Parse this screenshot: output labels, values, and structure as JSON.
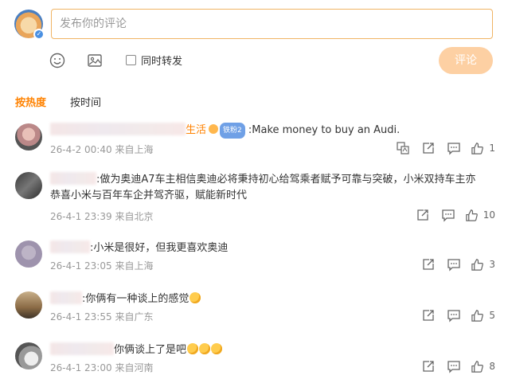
{
  "composer": {
    "placeholder": "发布你的评论",
    "repost_label": "同时转发",
    "submit_label": "评论"
  },
  "tabs": {
    "hot": "按热度",
    "time": "按时间"
  },
  "comments": [
    {
      "user_suffix": "生活",
      "level": "铁粉2",
      "text": ":Make money to buy an Audi.",
      "time": "26-4-2 00:40",
      "location": "来自上海",
      "likes": "1"
    },
    {
      "text_line1": ":做为奥迪A7车主相信奥迪必将秉持初心给驾乘者赋予可靠与突破，小米双持车主亦",
      "text_line2": "恭喜小米与百年车企并驾齐驱，赋能新时代",
      "time": "26-4-1 23:39",
      "location": "来自北京",
      "likes": "10"
    },
    {
      "text": ":小米是很好，但我更喜欢奥迪",
      "time": "26-4-1 23:05",
      "location": "来自上海",
      "likes": "3"
    },
    {
      "text": ":你俩有一种谈上的感觉",
      "time": "26-4-1 23:55",
      "location": "来自广东",
      "likes": "5"
    },
    {
      "text": "你俩谈上了是吧",
      "time": "26-4-1 23:00",
      "location": "来自河南",
      "likes": "8"
    }
  ],
  "icons": {
    "emoji": "emoji-icon",
    "image": "image-icon",
    "translate": "translate-icon",
    "repost": "repost-icon",
    "comment": "comment-icon",
    "like": "thumbs-up-icon"
  },
  "colors": {
    "accent": "#ff8200",
    "submit_bg": "#fdd0a3",
    "input_border": "#f0b464",
    "meta": "#999999"
  }
}
